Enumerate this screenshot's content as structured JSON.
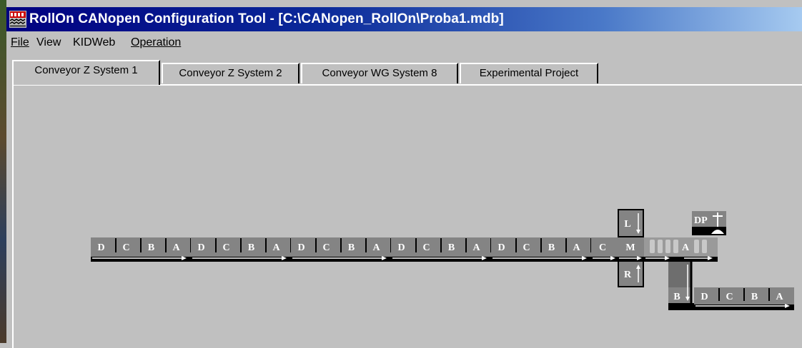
{
  "window": {
    "title": "RollOn CANopen Configuration Tool - [C:\\CANopen_RollOn\\Proba1.mdb]",
    "app_icon": "rollon-app-icon"
  },
  "menu": {
    "file": "File",
    "view": "View",
    "kidweb": "KIDWeb",
    "operation": "Operation"
  },
  "tabs": [
    {
      "label": "Conveyor Z System 1",
      "active": true
    },
    {
      "label": "Conveyor Z System 2",
      "active": false
    },
    {
      "label": "Conveyor WG System 8",
      "active": false
    },
    {
      "label": "Experimental Project",
      "active": false
    }
  ],
  "conveyor": {
    "main_modules": [
      {
        "labels": [
          "D",
          "C",
          "B",
          "A"
        ]
      },
      {
        "labels": [
          "D",
          "C",
          "B",
          "A"
        ]
      },
      {
        "labels": [
          "D",
          "C",
          "B",
          "A"
        ]
      },
      {
        "labels": [
          "D",
          "C",
          "B",
          "A"
        ]
      },
      {
        "labels": [
          "D",
          "C",
          "B",
          "A"
        ]
      }
    ],
    "junction_c": "C",
    "junction_m": "M",
    "junction_l": "L",
    "junction_r": "R",
    "after_m_a": "A",
    "drop_point": "DP",
    "branch_b": "B",
    "branch_module": {
      "labels": [
        "D",
        "C",
        "B",
        "A"
      ]
    }
  },
  "colors": {
    "title_start": "#000080",
    "title_end": "#a6caf0",
    "segment": "#848484",
    "background": "#c0c0c0"
  }
}
